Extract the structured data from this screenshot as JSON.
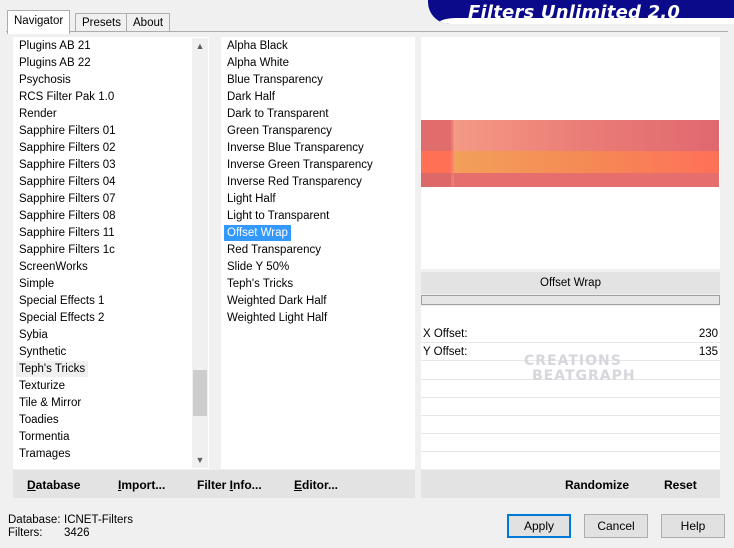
{
  "tabs": [
    {
      "label": "Navigator",
      "active": true
    },
    {
      "label": "Presets",
      "active": false
    },
    {
      "label": "About",
      "active": false
    }
  ],
  "title": "Filters Unlimited 2.0",
  "categories": [
    "Plugins AB 21",
    "Plugins AB 22",
    "Psychosis",
    "RCS Filter Pak 1.0",
    "Render",
    "Sapphire Filters 01",
    "Sapphire Filters 02",
    "Sapphire Filters 03",
    "Sapphire Filters 04",
    "Sapphire Filters 07",
    "Sapphire Filters 08",
    "Sapphire Filters 11",
    "Sapphire Filters 1c",
    "ScreenWorks",
    "Simple",
    "Special Effects 1",
    "Special Effects 2",
    "Sybia",
    "Synthetic",
    "Teph's Tricks",
    "Texturize",
    "Tile & Mirror",
    "Toadies",
    "Tormentia",
    "Tramages"
  ],
  "selected_category": "Teph's Tricks",
  "filters": [
    "Alpha Black",
    "Alpha White",
    "Blue Transparency",
    "Dark Half",
    "Dark to Transparent",
    "Green Transparency",
    "Inverse Blue Transparency",
    "Inverse Green Transparency",
    "Inverse Red Transparency",
    "Light Half",
    "Light to Transparent",
    "Offset Wrap",
    "Red Transparency",
    "Slide Y 50%",
    "Teph's Tricks",
    "Weighted Dark Half",
    "Weighted Light Half"
  ],
  "selected_filter": "Offset Wrap",
  "filter_name": "Offset Wrap",
  "params": [
    {
      "label": "X Offset:",
      "value": "230"
    },
    {
      "label": "Y Offset:",
      "value": "135"
    }
  ],
  "watermark": {
    "line1": "CREATIONS",
    "line2": "BEATGRAPH"
  },
  "toolbar": {
    "database": {
      "u": "D",
      "rest": "atabase"
    },
    "import": {
      "u": "I",
      "rest": "mport..."
    },
    "filter_info": {
      "pre": "Filter ",
      "u": "I",
      "rest": "nfo..."
    },
    "editor": {
      "u": "E",
      "rest": "ditor..."
    },
    "randomize": "Randomize",
    "reset": "Reset"
  },
  "status": {
    "database_label": "Database:",
    "database_value": "ICNET-Filters",
    "filters_label": "Filters:",
    "filters_value": "3426"
  },
  "buttons": {
    "apply": "Apply",
    "cancel": "Cancel",
    "help": "Help"
  },
  "colors": {
    "title_bg": "#0a0a8a",
    "selection": "#3399ff"
  }
}
